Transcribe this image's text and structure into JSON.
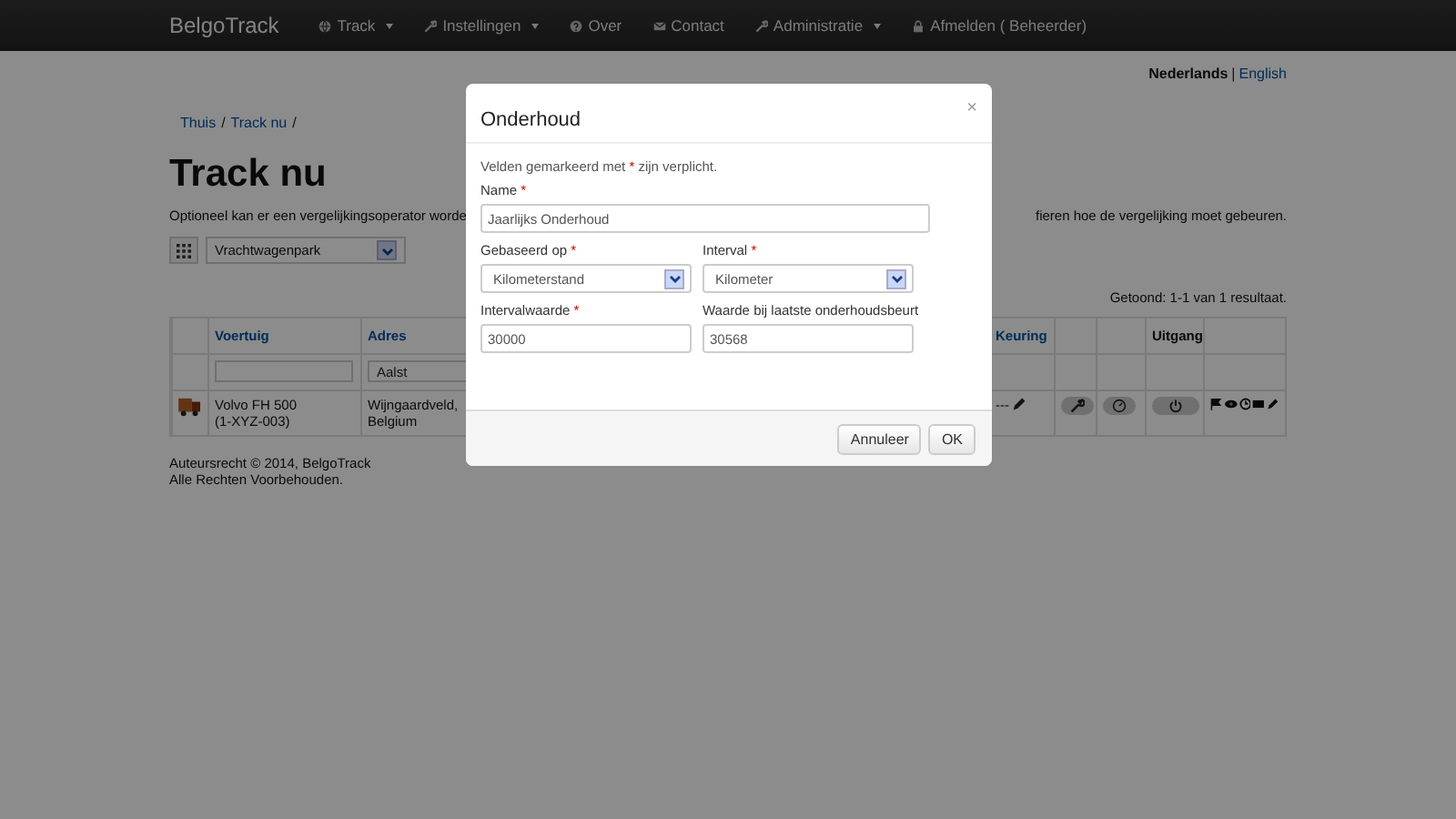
{
  "navbar": {
    "brand": "BelgoTrack",
    "items": [
      {
        "label": "Track",
        "dropdown": true
      },
      {
        "label": "Instellingen",
        "dropdown": true
      },
      {
        "label": "Over",
        "dropdown": false
      },
      {
        "label": "Contact",
        "dropdown": false
      },
      {
        "label": "Administratie",
        "dropdown": true
      },
      {
        "label": "Afmelden ( Beheerder)",
        "dropdown": false
      }
    ]
  },
  "languages": [
    {
      "label": "Nederlands",
      "selected": true
    },
    {
      "label": "English",
      "selected": false
    }
  ],
  "language_separator": "|",
  "breadcrumb": [
    {
      "label": "Thuis",
      "divider": "/"
    },
    {
      "label": "Track nu",
      "divider": "/"
    }
  ],
  "page_title": "Track nu",
  "description_fragments": [
    "Optioneel kan er een vergelijkingsoperator worde",
    "fieren hoe de vergelijking moet gebeuren."
  ],
  "fleet_select": {
    "value": "Vrachtwagenpark"
  },
  "summary": "Getoond: 1-1 van 1 resultaat.",
  "table": {
    "columns": [
      {
        "label": "Voertuig",
        "link": true
      },
      {
        "label": "Adres",
        "link": true
      },
      {
        "label": "Keuring",
        "link": true
      },
      {
        "label": "Uitgang",
        "link": false
      }
    ],
    "address_filter": "Aalst",
    "rows": [
      {
        "vehicle": "Volvo FH 500",
        "plate": "(1-XYZ-003)",
        "address_line_1": "Wijngaardveld,",
        "address_line_2": "Belgium",
        "inspection": "---"
      }
    ]
  },
  "footer": [
    "Auteursrecht © 2014, BelgoTrack",
    "Alle Rechten Voorbehouden."
  ],
  "modal": {
    "title": "Onderhoud",
    "close": "×",
    "note_before": "Velden gemarkeerd met",
    "note_marker": "*",
    "note_after": "zijn verplicht.",
    "fields": [
      {
        "label": "Name",
        "required": true,
        "kind": "text",
        "value": "Jaarlijks Onderhoud",
        "wide": true
      },
      {
        "label": "Gebaseerd op",
        "required": true,
        "kind": "select",
        "value": "Kilometerstand",
        "wide": false
      },
      {
        "label": "Interval",
        "required": true,
        "kind": "select",
        "value": "Kilometer",
        "wide": false
      },
      {
        "label": "Intervalwaarde",
        "required": true,
        "kind": "text",
        "value": "30000",
        "wide": false
      },
      {
        "label": "Waarde bij laatste onderhoudsbeurt",
        "required": false,
        "kind": "text",
        "value": "30568",
        "wide": false
      }
    ],
    "buttons": [
      "Annuleer",
      "OK"
    ]
  }
}
